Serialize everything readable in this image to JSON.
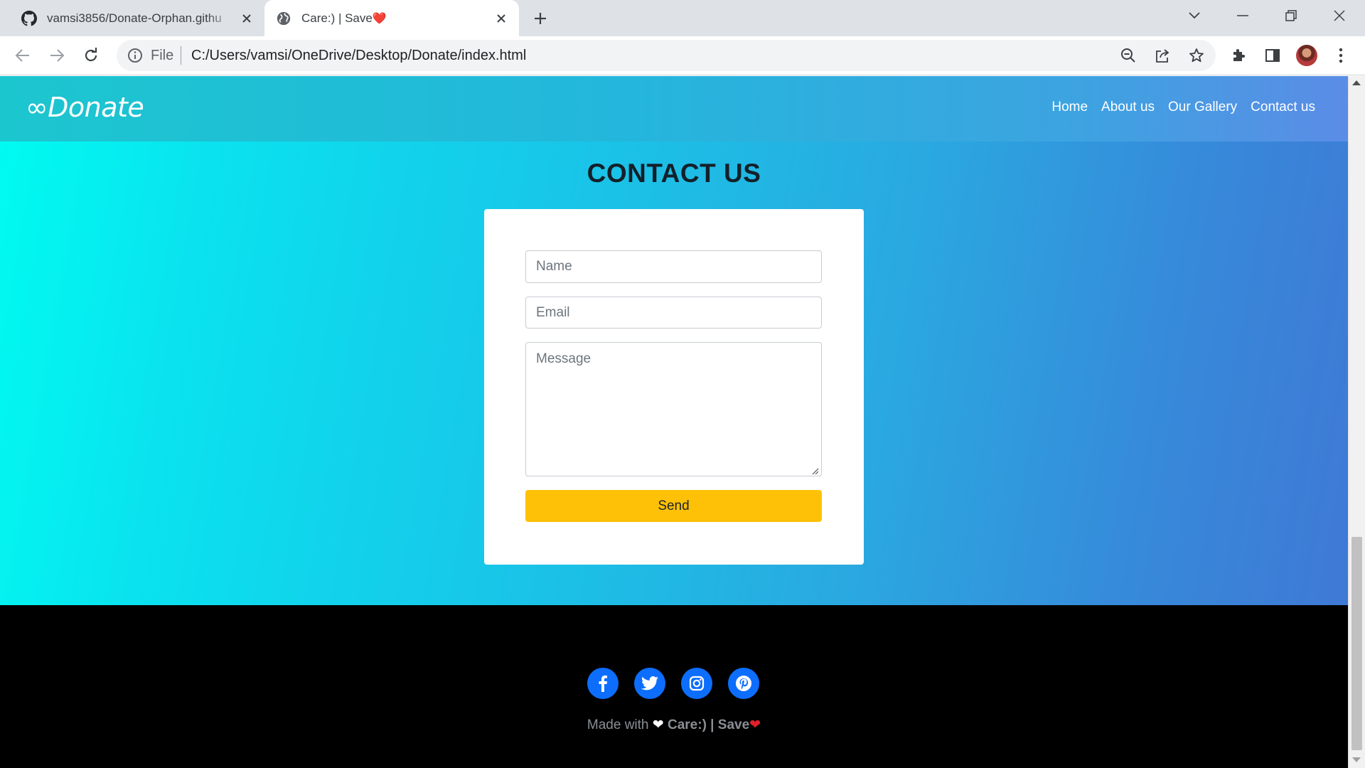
{
  "browser": {
    "tabs": [
      {
        "title": "vamsi3856/Donate-Orphan.githu",
        "icon": "github-icon",
        "active": false
      },
      {
        "title": "Care:) | Save",
        "title_suffix": "❤️",
        "icon": "globe-icon",
        "active": true
      }
    ],
    "address_scheme": "File",
    "url": "C:/Users/vamsi/OneDrive/Desktop/Donate/index.html"
  },
  "site": {
    "brand": "∞Donate",
    "nav": [
      "Home",
      "About us",
      "Our Gallery",
      "Contact us"
    ]
  },
  "contact": {
    "heading": "CONTACT US",
    "name_placeholder": "Name",
    "email_placeholder": "Email",
    "message_placeholder": "Message",
    "send_label": "Send"
  },
  "footer": {
    "social": [
      "facebook-icon",
      "twitter-icon",
      "instagram-icon",
      "pinterest-icon"
    ],
    "made_with": "Made with",
    "heart_white": "❤",
    "brand_text": "Care:) | Save",
    "heart_red": "❤"
  },
  "colors": {
    "accent_button": "#ffc107",
    "social_blue": "#0d6efd",
    "footer_bg": "#000000"
  }
}
